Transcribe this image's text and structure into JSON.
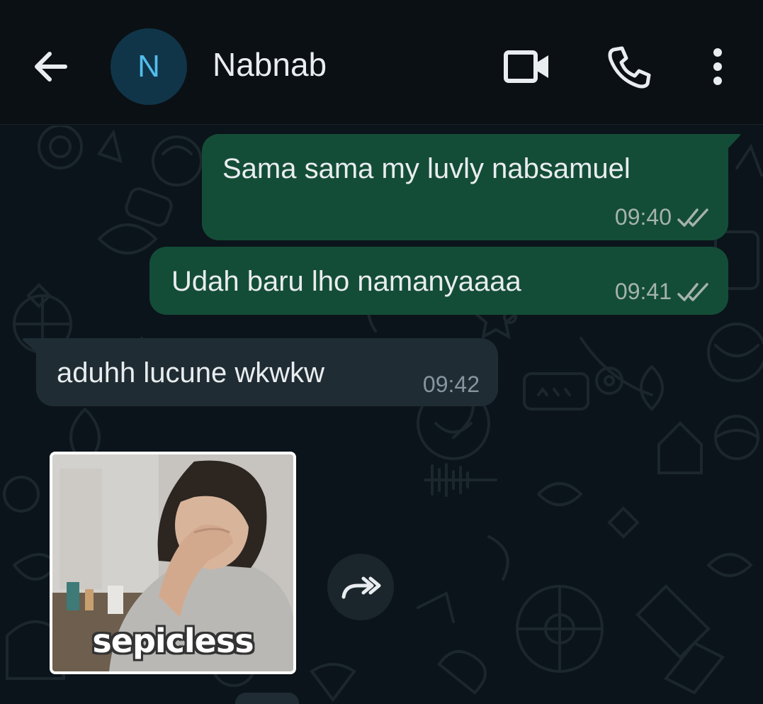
{
  "header": {
    "avatar_initial": "N",
    "contact_name": "Nabnab",
    "icons": [
      "back-arrow-icon",
      "video-call-icon",
      "phone-icon",
      "more-vert-icon"
    ]
  },
  "messages": [
    {
      "direction": "outgoing",
      "text": "Sama sama my luvly nabsamuel",
      "time": "09:40",
      "status": "read-double-check"
    },
    {
      "direction": "outgoing",
      "text": "Udah baru lho namanyaaaa",
      "time": "09:41",
      "status": "read-double-check"
    },
    {
      "direction": "incoming",
      "text": "aduhh lucune wkwkw",
      "time": "09:42"
    },
    {
      "direction": "incoming",
      "type": "sticker",
      "caption": "sepicless"
    }
  ],
  "colors": {
    "header_bg": "#0b1014",
    "chat_bg": "#0b141a",
    "outgoing_bubble": "#144d37",
    "incoming_bubble": "#1f2c33",
    "avatar_bg": "#103548",
    "avatar_text": "#53bdeb"
  }
}
